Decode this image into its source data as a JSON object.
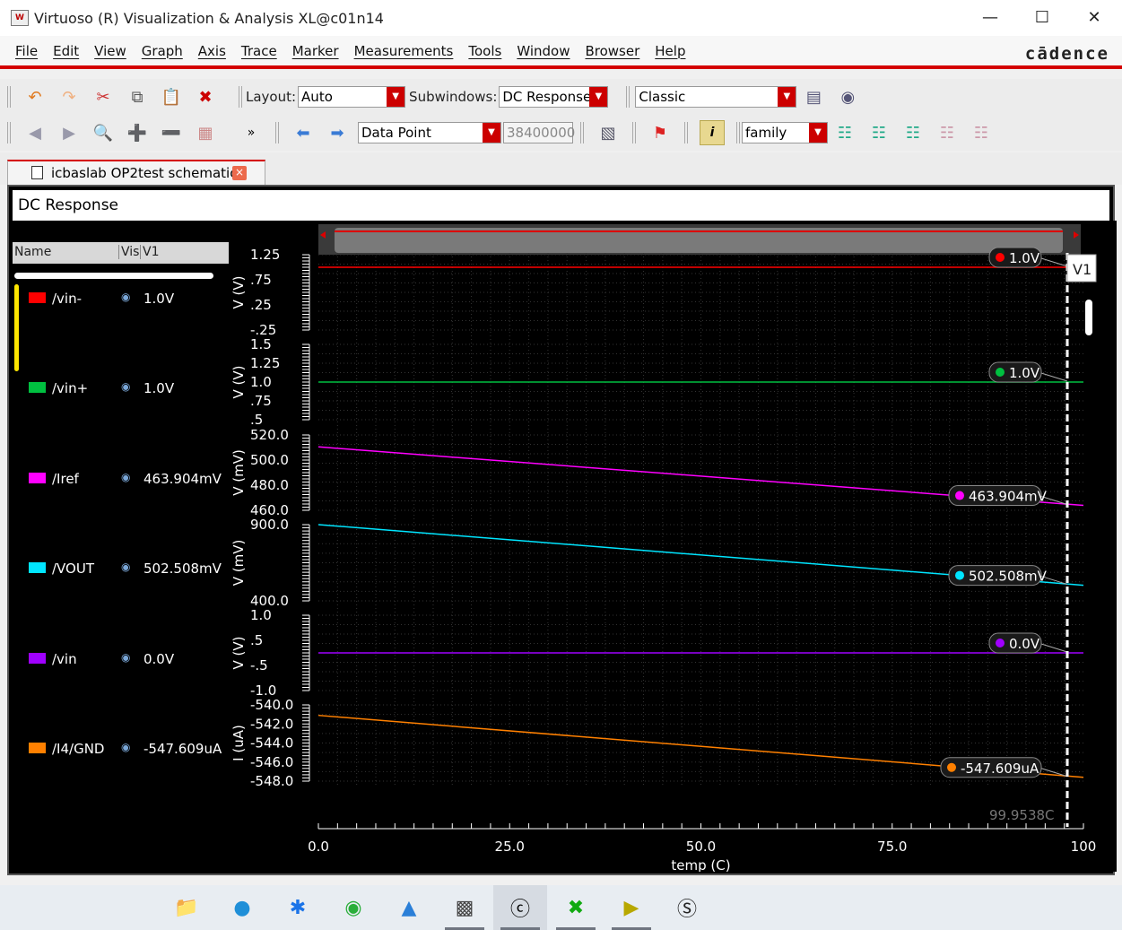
{
  "window": {
    "title": "Virtuoso (R) Visualization & Analysis XL@c01n14"
  },
  "menu": [
    "File",
    "Edit",
    "View",
    "Graph",
    "Axis",
    "Trace",
    "Marker",
    "Measurements",
    "Tools",
    "Window",
    "Browser",
    "Help"
  ],
  "brand": "cādence",
  "toolbar": {
    "layout_label": "Layout:",
    "layout_value": "Auto",
    "subwindows_label": "Subwindows:",
    "subwindows_value": "DC Response",
    "style_value": "Classic",
    "mode_value": "Data Point",
    "point_value": "38400000",
    "family_value": "family"
  },
  "tab": {
    "label": "icbaslab OP2test schematic"
  },
  "panel": {
    "title": "DC Response"
  },
  "legend": {
    "col_name": "Name",
    "col_vis": "Vis",
    "col_v1": "V1",
    "rows": [
      {
        "name": "/vin-",
        "value": "1.0V",
        "color": "#ff0000"
      },
      {
        "name": "/vin+",
        "value": "1.0V",
        "color": "#00c040"
      },
      {
        "name": "/Iref",
        "value": "463.904mV",
        "color": "#ff00ff"
      },
      {
        "name": "/VOUT",
        "value": "502.508mV",
        "color": "#00e5ff"
      },
      {
        "name": "/vin",
        "value": "0.0V",
        "color": "#a000ff"
      },
      {
        "name": "/I4/GND",
        "value": "-547.609uA",
        "color": "#ff8000"
      }
    ]
  },
  "marker": {
    "name": "V1",
    "overlap_text": "99.9538C"
  },
  "chart_data": [
    {
      "type": "line",
      "series": [
        {
          "name": "/vin-",
          "x": [
            0,
            100
          ],
          "values": [
            1.0,
            1.0
          ]
        }
      ],
      "ylabel": "V (V)",
      "yticks": [
        "1.25",
        ".75",
        ".25",
        "-.25"
      ],
      "ylim": [
        -0.25,
        1.25
      ],
      "marker_label": "1.0V"
    },
    {
      "type": "line",
      "series": [
        {
          "name": "/vin+",
          "x": [
            0,
            100
          ],
          "values": [
            1.0,
            1.0
          ]
        }
      ],
      "ylabel": "V (V)",
      "yticks": [
        "1.5",
        "1.25",
        "1.0",
        ".75",
        ".5"
      ],
      "ylim": [
        0.5,
        1.5
      ],
      "marker_label": "1.0V"
    },
    {
      "type": "line",
      "series": [
        {
          "name": "/Iref",
          "x": [
            0,
            100
          ],
          "values": [
            510.5,
            463.9
          ]
        }
      ],
      "ylabel": "V (mV)",
      "yticks": [
        "520.0",
        "500.0",
        "480.0",
        "460.0"
      ],
      "ylim": [
        460,
        520
      ],
      "marker_label": "463.904mV"
    },
    {
      "type": "line",
      "series": [
        {
          "name": "/VOUT",
          "x": [
            0,
            100
          ],
          "values": [
            900,
            502.5
          ]
        }
      ],
      "ylabel": "V (mV)",
      "yticks": [
        "900.0",
        "400.0"
      ],
      "ylim": [
        400,
        900
      ],
      "marker_label": "502.508mV"
    },
    {
      "type": "line",
      "series": [
        {
          "name": "/vin",
          "x": [
            0,
            100
          ],
          "values": [
            0.0,
            0.0
          ]
        }
      ],
      "ylabel": "V (V)",
      "yticks": [
        "1.0",
        ".5",
        "-.5",
        "-1.0"
      ],
      "ylim": [
        -1.0,
        1.0
      ],
      "marker_label": "0.0V"
    },
    {
      "type": "line",
      "series": [
        {
          "name": "/I4/GND",
          "x": [
            0,
            100
          ],
          "values": [
            -541.1,
            -547.6
          ]
        }
      ],
      "ylabel": "I (uA)",
      "yticks": [
        "-540.0",
        "-542.0",
        "-544.0",
        "-546.0",
        "-548.0"
      ],
      "ylim": [
        -548,
        -540
      ],
      "marker_label": "-547.609uA"
    }
  ],
  "xaxis": {
    "label": "temp (C)",
    "ticks": [
      "0.0",
      "25.0",
      "50.0",
      "75.0",
      "100"
    ],
    "range": [
      0,
      100
    ]
  },
  "taskbar": [
    "file-explorer",
    "edge",
    "baidu-netdisk",
    "wechat",
    "photos",
    "terminal",
    "cadence",
    "xming",
    "pdf-reader",
    "typora"
  ]
}
